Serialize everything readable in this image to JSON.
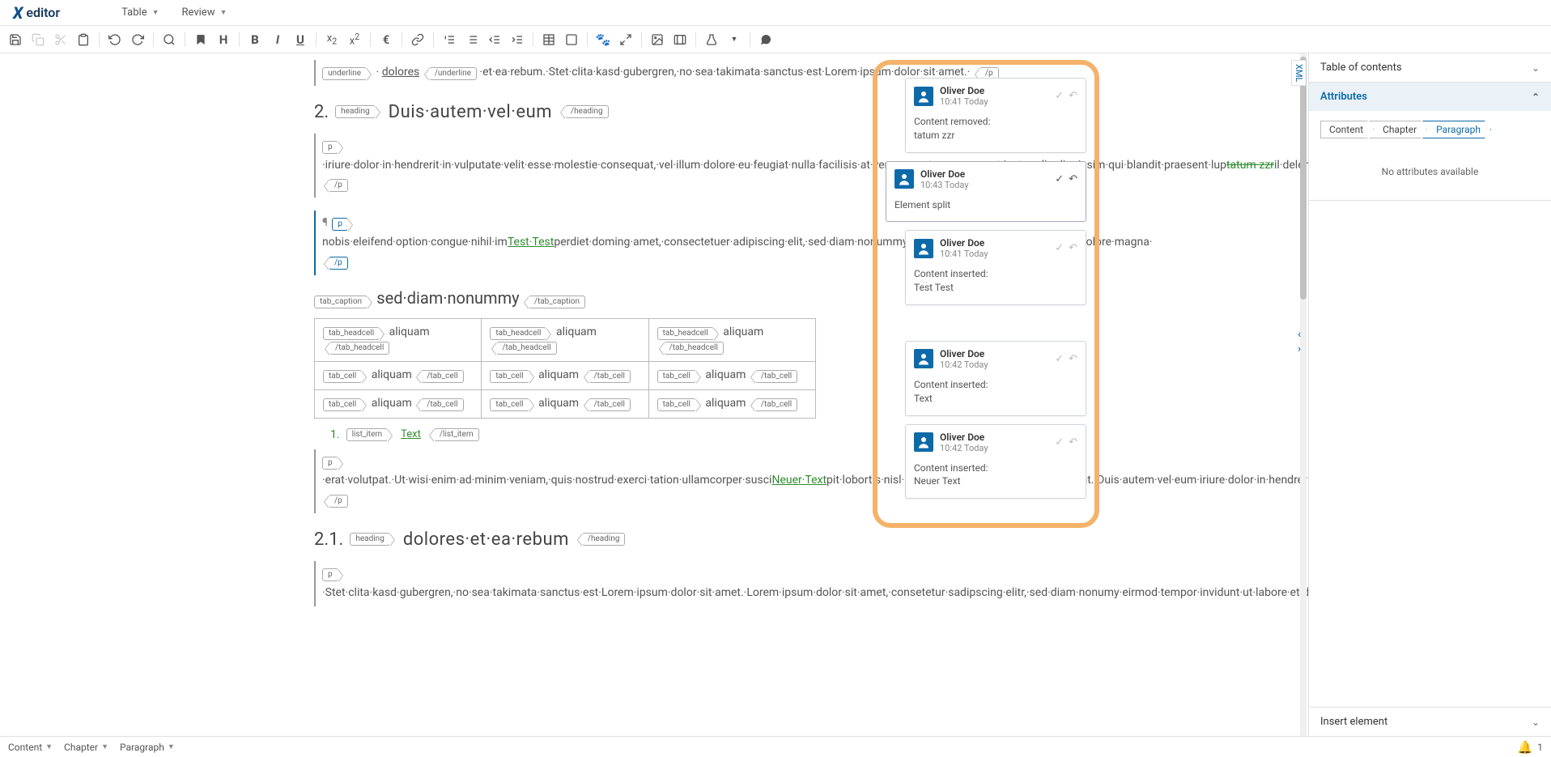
{
  "menubar": {
    "logo_text": "editor",
    "items": [
      "Table",
      "Review"
    ]
  },
  "toolbar": {
    "groups": [
      [
        {
          "n": "save-icon",
          "i": "save",
          "d": false
        },
        {
          "n": "copy-icon",
          "i": "copy",
          "d": true
        },
        {
          "n": "cut-icon",
          "i": "cut",
          "d": true
        },
        {
          "n": "paste-icon",
          "i": "paste",
          "d": false
        }
      ],
      [
        {
          "n": "undo-icon",
          "i": "undo",
          "d": false
        },
        {
          "n": "redo-icon",
          "i": "redo",
          "d": false
        }
      ],
      [
        {
          "n": "search-icon",
          "i": "search",
          "d": false
        }
      ],
      [
        {
          "n": "bookmark-icon",
          "i": "bookmark",
          "d": false
        },
        {
          "n": "heading-icon",
          "i": "H",
          "d": false
        }
      ],
      [
        {
          "n": "bold-icon",
          "i": "B",
          "d": false
        },
        {
          "n": "italic-icon",
          "i": "I",
          "d": false
        },
        {
          "n": "underline-icon",
          "i": "U",
          "d": false
        }
      ],
      [
        {
          "n": "subscript-icon",
          "i": "x₂",
          "d": false
        },
        {
          "n": "superscript-icon",
          "i": "x²",
          "d": false
        }
      ],
      [
        {
          "n": "euro-icon",
          "i": "€",
          "d": false
        }
      ],
      [
        {
          "n": "link-icon",
          "i": "link",
          "d": false
        }
      ],
      [
        {
          "n": "ordered-list-icon",
          "i": "ol",
          "d": false
        },
        {
          "n": "unordered-list-icon",
          "i": "ul",
          "d": false
        },
        {
          "n": "outdent-icon",
          "i": "outd",
          "d": false
        },
        {
          "n": "indent-icon",
          "i": "ind",
          "d": false
        }
      ],
      [
        {
          "n": "table-icon",
          "i": "table",
          "d": false
        },
        {
          "n": "checkbox-icon",
          "i": "check",
          "d": false
        }
      ],
      [
        {
          "n": "paw-icon",
          "i": "paw",
          "d": false
        },
        {
          "n": "expand-icon",
          "i": "expand",
          "d": false
        }
      ],
      [
        {
          "n": "image-icon",
          "i": "img",
          "d": false
        },
        {
          "n": "video-icon",
          "i": "vid",
          "d": false
        }
      ],
      [
        {
          "n": "flask-icon",
          "i": "flask",
          "d": false
        },
        {
          "n": "flask-caret-icon",
          "i": "caret",
          "d": false
        }
      ],
      [
        {
          "n": "comment-icon",
          "i": "comment",
          "d": false
        }
      ]
    ]
  },
  "content": {
    "frag1_pre": "·",
    "frag1_link": "dolores",
    "frag1_post": "·et·ea·rebum.·Stet·clita·kasd·gubergren,·no·sea·takimata·sanctus·est·Lorem·ipsum·dolor·sit·amet.·",
    "tags": {
      "underline": "underline",
      "underline_c": "/underline",
      "p": "p",
      "p_c": "/p",
      "heading": "heading",
      "heading_c": "/heading",
      "tab_caption": "tab_caption",
      "tab_caption_c": "/tab_caption",
      "tab_headcell": "tab_headcell",
      "tab_headcell_c": "/tab_headcell",
      "tab_cell": "tab_cell",
      "tab_cell_c": "/tab_cell",
      "list_item": "list_item",
      "list_item_c": "/list_item"
    },
    "h2_num": "2.",
    "h2_text": "Duis·autem·vel·eum",
    "p2a": "·iriure·dolor·in·hendrerit·in·vulputate·velit·esse·molestie·consequat,·vel·illum·dolore·eu·feugiat·nulla·facilisis·at·vero·eros·et·accumsan·et·iusto·odio·dignissim·qui·blandit·praesent·lup",
    "p2_strike": "tatum·zzr",
    "p2b": "il·delenit·augue·duis·dolore·te·feugait·nulla·facilisi.·Nam·liber·tempor·cum·soluta·",
    "p3a": "nobis·eleifend·option·congue·nihil·im",
    "p3_link": "Test·Test",
    "p3b": "perdiet·doming·amet,·consectetuer·adipiscing·elit,·sed·diam·nonummy·nibh·euismod·tincidunt·ut·laoreet·dolore·magna·",
    "caption": "sed·diam·nonummy",
    "cell": "aliquam",
    "list_num": "1.",
    "list_link": "Text",
    "p4a": "·erat·volutpat.·Ut·wisi·enim·ad·minim·veniam,·quis·nostrud·exerci·tation·ullamcorper·susci",
    "p4_link": "Neuer·Text",
    "p4b": "pit·lobortis·nisl·ut·aliquip·ex·ea·commodo·consequat.·Duis·autem·vel·eum·iriure·dolor·in·hendrerit·in·vulputate·velit·esse·molestie·consequat,·vel·illum·dolore·eu·feugiat·nulla·facilisis.·At·vero·eos·et·accusam·et·justo·duo·",
    "h21_num": "2.1.",
    "h21_text": "dolores·et·ea·rebum",
    "p5": "·Stet·clita·kasd·gubergren,·no·sea·takimata·sanctus·est·Lorem·ipsum·dolor·sit·amet.·Lorem·ipsum·dolor·sit·amet,·consetetur·sadipscing·elitr,·sed·diam·nonumy·eirmod·tempor·invidunt·ut·labore·et·dolore·magna·aliquyam·erat,·sed·diam·voluptua.·At·vero·eos·et·accusam·et·justo·duo·dolores·et·ea·rebum.·Stet·clita·kasd·gubergren,·no·sea·takimata·sanctus·est·Lorem·ipsum·dolor·sit·amet,·consetetur·sadipscing·elitr,·At·accusam·aliquyam·diam·diam·dolore·dolores·duo·eirmod·eos·erat,·et·nonumy·sed·tempor·et·et·invidunt·justo·labore·Stet·clita·ea·et·gubergren,·kasd·magna·no·rebum.·sanctus·sea·sed·takimata·ut·vero·voluptua.·est·Lorem·ipsum·dolor·sit·amet."
  },
  "comments": [
    {
      "author": "Oliver Doe",
      "time": "10:41 Today",
      "body_label": "Content removed:",
      "body_value": "tatum zzr",
      "indent": true,
      "active": false
    },
    {
      "author": "Oliver Doe",
      "time": "10:43 Today",
      "body_label": "Element split",
      "body_value": "",
      "indent": false,
      "active": true
    },
    {
      "author": "Oliver Doe",
      "time": "10:41 Today",
      "body_label": "Content inserted:",
      "body_value": "Test Test",
      "indent": true,
      "active": false
    },
    {
      "author": "Oliver Doe",
      "time": "10:42 Today",
      "body_label": "Content inserted:",
      "body_value": "Text",
      "indent": true,
      "active": false
    },
    {
      "author": "Oliver Doe",
      "time": "10:42 Today",
      "body_label": "Content inserted:",
      "body_value": "Neuer Text",
      "indent": true,
      "active": false
    }
  ],
  "sidebar": {
    "xml_tab": "XML",
    "panels": {
      "toc": "Table of contents",
      "attr": "Attributes",
      "insert": "Insert element"
    },
    "breadcrumb": [
      "Content",
      "Chapter",
      "Paragraph"
    ],
    "no_attr_msg": "No attributes available"
  },
  "statusbar": {
    "items": [
      "Content",
      "Chapter",
      "Paragraph"
    ],
    "notif_count": "1"
  }
}
